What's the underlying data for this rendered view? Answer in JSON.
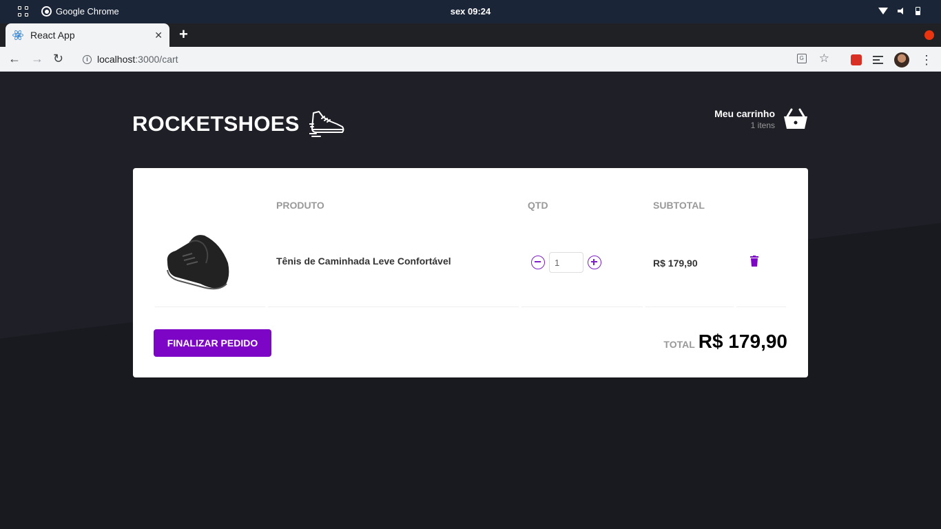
{
  "os": {
    "app_name": "Google Chrome",
    "clock": "sex 09:24"
  },
  "browser": {
    "tab_title": "React App",
    "tab_close": "✕",
    "new_tab": "+",
    "url_host": "localhost",
    "url_path": ":3000/cart"
  },
  "header": {
    "logo": "ROCKETSHOES",
    "cart_title": "Meu carrinho",
    "cart_count": "1 itens"
  },
  "table": {
    "headers": [
      "PRODUTO",
      "QTD",
      "SUBTOTAL"
    ],
    "rows": [
      {
        "image": "shoe-image",
        "title": "Tênis de Caminhada Leve Confortável",
        "quantity": "1",
        "subtotal": "R$ 179,90"
      }
    ]
  },
  "footer": {
    "checkout_label": "FINALIZAR PEDIDO",
    "total_label": "TOTAL",
    "total_value": "R$ 179,90"
  },
  "colors": {
    "accent": "#7d06c6",
    "background": "#191920"
  }
}
